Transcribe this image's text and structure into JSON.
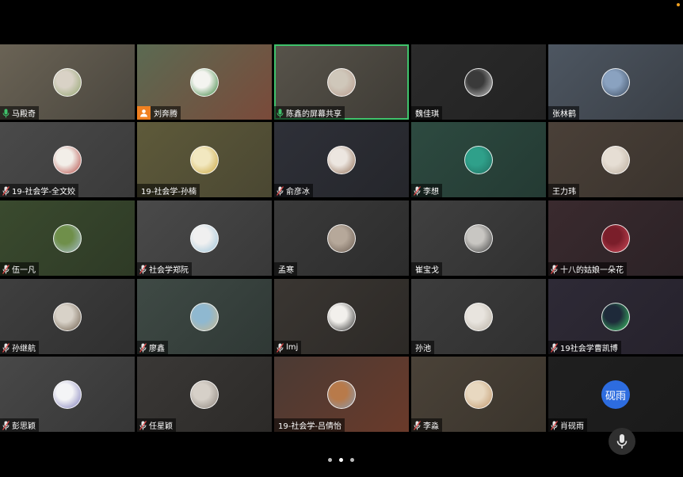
{
  "participants": [
    {
      "name": "马殿奇",
      "mic": "on",
      "bg": [
        "#6a6355",
        "#4a463e"
      ],
      "avatar": [
        "#d9d2c6",
        "#8fa36b"
      ],
      "active": false
    },
    {
      "name": "刘奔腾",
      "mic": "person",
      "bg": [
        "#5b6a52",
        "#7a4a3a"
      ],
      "avatar": [
        "#f4f4f0",
        "#2e7d32"
      ],
      "active": false
    },
    {
      "name": "陈鑫的屏幕共享",
      "mic": "on",
      "bg": [
        "#57534a",
        "#3e3b35"
      ],
      "avatar": [
        "#cfc7ba",
        "#b79a8c"
      ],
      "active": true
    },
    {
      "name": "魏佳琪",
      "mic": "none",
      "bg": [
        "#2b2b2b",
        "#222"
      ],
      "avatar": [
        "#3a3a3a",
        "#c8c8c8"
      ],
      "active": false
    },
    {
      "name": "张林鹤",
      "mic": "none",
      "bg": [
        "#4d5661",
        "#3a3f46"
      ],
      "avatar": [
        "#8aa2c0",
        "#3b4a5e"
      ],
      "active": false
    },
    {
      "name": "19-社会学-全文姣",
      "mic": "muted",
      "bg": [
        "#4a4a4a",
        "#3a3a3a"
      ],
      "avatar": [
        "#f2eee8",
        "#b0403a"
      ],
      "active": false
    },
    {
      "name": "19-社会学-孙楠",
      "mic": "none",
      "bg": [
        "#5e5a3a",
        "#4a4732"
      ],
      "avatar": [
        "#f2e8c0",
        "#c9a43a"
      ],
      "active": false
    },
    {
      "name": "俞彦冰",
      "mic": "muted",
      "bg": [
        "#2e3038",
        "#25262b"
      ],
      "avatar": [
        "#ece6e0",
        "#8f6b52"
      ],
      "active": false
    },
    {
      "name": "李想",
      "mic": "muted",
      "bg": [
        "#2d4a40",
        "#243a33"
      ],
      "avatar": [
        "#2fa08a",
        "#1f6e60"
      ],
      "active": false
    },
    {
      "name": "王力玮",
      "mic": "none",
      "bg": [
        "#4a4038",
        "#3a332d"
      ],
      "avatar": [
        "#e6ded4",
        "#b9ab9b"
      ],
      "active": false
    },
    {
      "name": "伍一凡",
      "mic": "muted",
      "bg": [
        "#3a4a2e",
        "#2e3a26"
      ],
      "avatar": [
        "#6f8f4a",
        "#a9c0d0"
      ],
      "active": false
    },
    {
      "name": "社会学郑阮",
      "mic": "muted",
      "bg": [
        "#4a4a4a",
        "#383838"
      ],
      "avatar": [
        "#f0f0f0",
        "#9ac2d8"
      ],
      "active": false
    },
    {
      "name": "孟寒",
      "mic": "none",
      "bg": [
        "#3a3a3a",
        "#2c2c2c"
      ],
      "avatar": [
        "#b6a89a",
        "#6b5d52"
      ],
      "active": false
    },
    {
      "name": "崔宝戈",
      "mic": "none",
      "bg": [
        "#404040",
        "#303030"
      ],
      "avatar": [
        "#c8c6c2",
        "#3d3d3d"
      ],
      "active": false
    },
    {
      "name": "十八的姑娘一朵花",
      "mic": "muted",
      "bg": [
        "#3a2a2e",
        "#2b2226"
      ],
      "avatar": [
        "#7a1e2a",
        "#d04a5a"
      ],
      "active": false
    },
    {
      "name": "孙继航",
      "mic": "muted",
      "bg": [
        "#3f3f3f",
        "#2f2f2f"
      ],
      "avatar": [
        "#d8d2c8",
        "#6a5a48"
      ],
      "active": false
    },
    {
      "name": "廖鑫",
      "mic": "muted",
      "bg": [
        "#3f4a45",
        "#2f3835"
      ],
      "avatar": [
        "#8fb8d0",
        "#c8b890"
      ],
      "active": false
    },
    {
      "name": "lmj",
      "mic": "muted",
      "bg": [
        "#3a3632",
        "#2c2926"
      ],
      "avatar": [
        "#f2f0ec",
        "#2a2a2a"
      ],
      "active": false
    },
    {
      "name": "孙池",
      "mic": "none",
      "bg": [
        "#3d3d3d",
        "#2f2f2f"
      ],
      "avatar": [
        "#e8e4de",
        "#b8b0a4"
      ],
      "active": false
    },
    {
      "name": "19社会学曹凯博",
      "mic": "muted",
      "bg": [
        "#2e2a36",
        "#26222c"
      ],
      "avatar": [
        "#1e2a3a",
        "#3fcf6a"
      ],
      "active": false
    },
    {
      "name": "彭思颖",
      "mic": "muted",
      "bg": [
        "#484848",
        "#363636"
      ],
      "avatar": [
        "#f4f4f6",
        "#7a78b8"
      ],
      "active": false
    },
    {
      "name": "任星颖",
      "mic": "muted",
      "bg": [
        "#3a3836",
        "#2c2a28"
      ],
      "avatar": [
        "#d6d0c8",
        "#8a827a"
      ],
      "active": false
    },
    {
      "name": "19-社会学-吕倩怡",
      "mic": "none",
      "bg": [
        "#4a3a34",
        "#6a3a2a"
      ],
      "avatar": [
        "#b87a4a",
        "#8a9ab0"
      ],
      "active": false
    },
    {
      "name": "李淼",
      "mic": "muted",
      "bg": [
        "#4a4238",
        "#3a342c"
      ],
      "avatar": [
        "#e8d8c0",
        "#c0966a"
      ],
      "active": false
    },
    {
      "name": "肖砚雨",
      "mic": "muted",
      "bg": [
        "#1f1f1f",
        "#1a1a1a"
      ],
      "avatar_text": "砚雨",
      "active": false
    }
  ],
  "colors": {
    "active_border": "#3fc26b",
    "mic_on": "#3fc26b",
    "mic_muted": "#e04848",
    "person_badge": "#f08020",
    "text_avatar_bg": "#2d6cdf"
  },
  "pager": {
    "pages": 3,
    "current": 2
  },
  "icons": {
    "fab": "microphone-icon"
  }
}
